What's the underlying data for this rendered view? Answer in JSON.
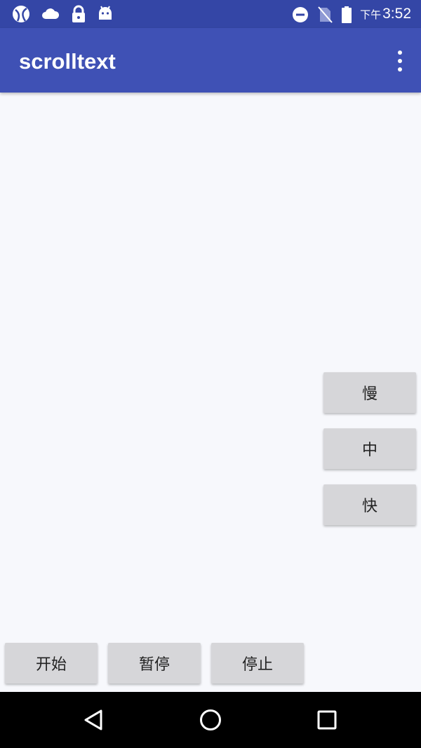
{
  "status_bar": {
    "clock_ampm": "下午",
    "clock_time": "3:52",
    "left_icons": [
      "ball-icon",
      "cloud-icon",
      "lock-icon",
      "android-icon"
    ],
    "right_icons": [
      "dnd-icon",
      "no-sim-icon",
      "battery-icon"
    ]
  },
  "app_bar": {
    "title": "scrolltext",
    "menu_icon": "overflow-menu-icon"
  },
  "speed_buttons": {
    "slow": "慢",
    "medium": "中",
    "fast": "快"
  },
  "control_buttons": {
    "start": "开始",
    "pause": "暂停",
    "stop": "停止"
  },
  "nav_bar": {
    "icons": [
      "back-icon",
      "home-icon",
      "recents-icon"
    ]
  },
  "colors": {
    "status_bar": "#3446a6",
    "app_bar": "#3f51b5",
    "background": "#f7f8fc",
    "button": "#d6d6d9"
  }
}
